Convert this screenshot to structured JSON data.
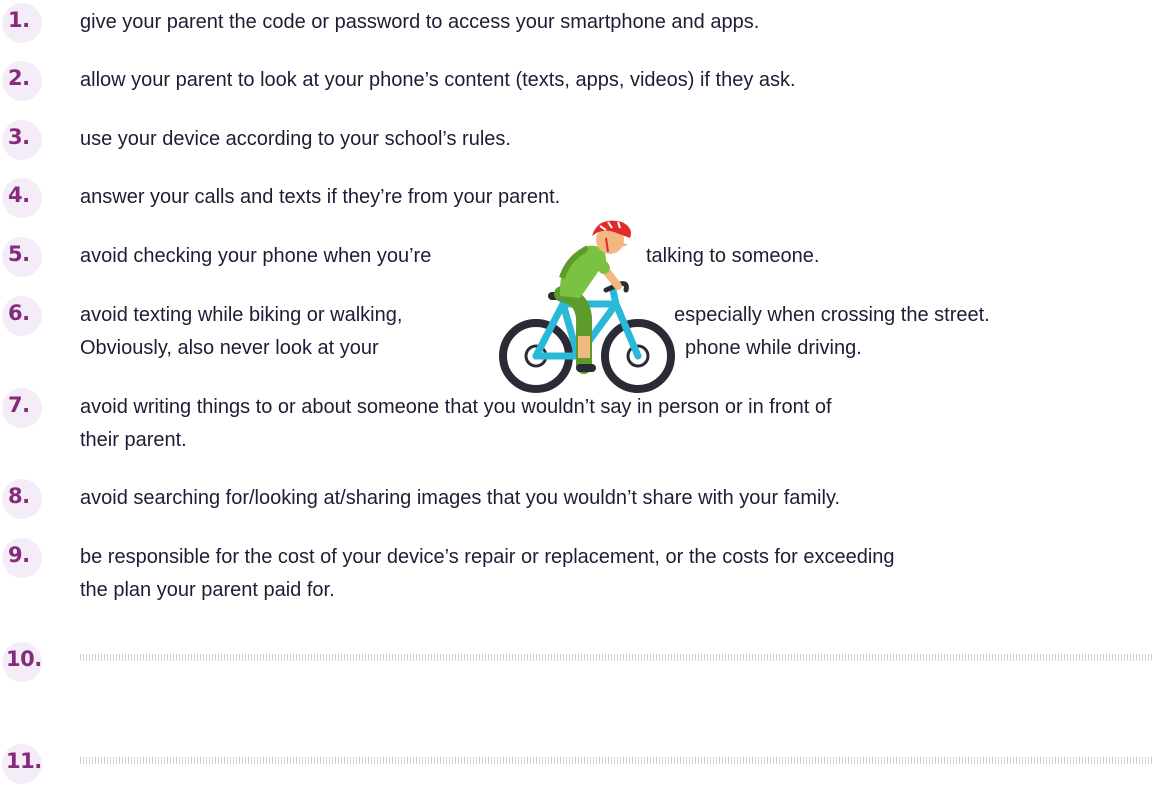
{
  "items": [
    {
      "num": "1.",
      "text": "give your parent the code or password to access your smartphone and apps."
    },
    {
      "num": "2.",
      "text": "allow your parent to look at your phone’s content (texts, apps, videos) if they ask."
    },
    {
      "num": "3.",
      "text": "use your device according to your school’s rules."
    },
    {
      "num": "4.",
      "text": "answer your calls and texts if they’re from your parent."
    },
    {
      "num": "5.",
      "text_a": "avoid checking your phone when you’re",
      "text_b": "talking to someone."
    },
    {
      "num": "6.",
      "line1_a": "avoid texting while biking or walking,",
      "line1_b": "especially when crossing the street.",
      "line2_a": "Obviously, also never look at your",
      "line2_b": "phone while driving."
    },
    {
      "num": "7.",
      "line1": "avoid writing things to or about someone that you wouldn’t say in person or in front of",
      "line2": "their parent."
    },
    {
      "num": "8.",
      "text": "avoid searching for/looking at/sharing images that you wouldn’t share with your family."
    },
    {
      "num": "9.",
      "line1": "be responsible for the cost of your device’s repair or replacement, or the costs for exceeding",
      "line2": "the plan your parent paid for."
    },
    {
      "num": "10.",
      "text": ""
    },
    {
      "num": "11.",
      "text": ""
    }
  ],
  "colors": {
    "number": "#852a7d",
    "bubble": "#f4edf7",
    "text": "#1f1d35"
  },
  "illustration": "cyclist-with-helmet"
}
